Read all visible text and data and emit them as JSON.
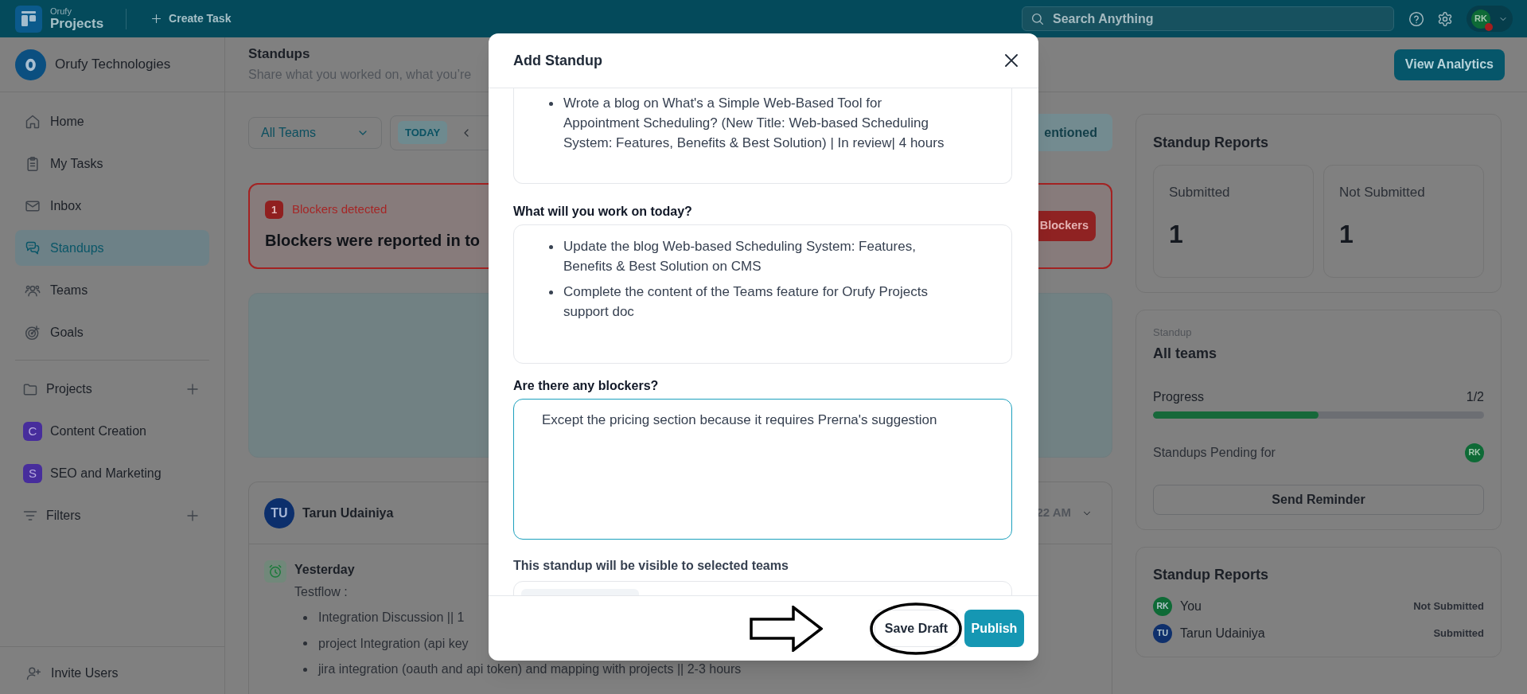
{
  "topbar": {
    "logo_caption": "Orufy",
    "logo_title": "Projects",
    "create_task": "Create Task",
    "search": {
      "placeholder": "Search Anything"
    },
    "user_initials": "RK"
  },
  "sidebar": {
    "organization": "Orufy Technologies",
    "nav": [
      {
        "label": "Home",
        "selected": false
      },
      {
        "label": "My Tasks",
        "selected": false
      },
      {
        "label": "Inbox",
        "selected": false
      },
      {
        "label": "Standups",
        "selected": true
      },
      {
        "label": "Teams",
        "selected": false
      },
      {
        "label": "Goals",
        "selected": false
      }
    ],
    "sections": [
      {
        "label": "Projects",
        "items": [
          {
            "initial": "C",
            "label": "Content Creation"
          },
          {
            "initial": "S",
            "label": "SEO and Marketing"
          }
        ]
      },
      {
        "label": "Filters"
      }
    ],
    "footer": "Invite Users"
  },
  "page": {
    "title": "Standups",
    "subtitle": "Share what you worked on, what you’re",
    "action": "View Analytics"
  },
  "filters": {
    "team": "All Teams",
    "date": "TODAY",
    "mention": "entioned"
  },
  "blockers": {
    "count": "1",
    "title": "Blockers detected",
    "message": "Blockers were reported in to",
    "action": "Blockers"
  },
  "standup": {
    "initials": "TU",
    "name": "Tarun Udainiya",
    "time": "22 AM",
    "section": "Yesterday",
    "project": "Testflow :",
    "items": [
      "Integration Discussion || 1",
      "project Integration (api key",
      "jira integration (oauth and api token) and mapping with projects || 2-3 hours"
    ]
  },
  "reports": {
    "title": "Standup Reports",
    "stats": [
      {
        "label": "Submitted",
        "value": "1"
      },
      {
        "label": "Not Submitted",
        "value": "1"
      }
    ]
  },
  "team_progress": {
    "caption": "Standup",
    "title": "All teams",
    "label": "Progress",
    "reading": "1/2",
    "level": 0.5,
    "pending_label": "Standups Pending for",
    "pending_initials": "RK",
    "button": "Send Reminder"
  },
  "report_list": {
    "title": "Standup Reports",
    "rows": [
      {
        "initials": "RK",
        "name": "You",
        "status": "Not Submitted",
        "color": "#0e6a36"
      },
      {
        "initials": "TU",
        "name": "Tarun Udainiya",
        "status": "Submitted",
        "color": "#0f306c"
      }
    ]
  },
  "modal": {
    "title": "Add Standup",
    "fields": [
      {
        "kind": "list",
        "items": [
          "Wrote a blog on What's a Simple Web-Based Tool for Appointment Scheduling? (New Title: Web-based Scheduling System: Features, Benefits & Best Solution) | In review| 4 hours"
        ],
        "focused": false
      },
      {
        "kind": "list",
        "label": "What will you work on today?",
        "items": [
          "Update the blog Web-based Scheduling System: Features, Benefits & Best Solution on CMS",
          "Complete the content of the Teams feature for Orufy Projects support doc"
        ],
        "focused": false
      },
      {
        "kind": "text",
        "label": "Are there any blockers?",
        "value": "Except the pricing section because it requires Prerna's suggestion",
        "focused": true
      }
    ],
    "visibility_label": "This standup will be visible to selected teams",
    "buttons": [
      {
        "label": "Save Draft",
        "kind": "secondary",
        "highlighted": true
      },
      {
        "label": "Publish",
        "kind": "primary",
        "highlighted": false
      }
    ]
  }
}
